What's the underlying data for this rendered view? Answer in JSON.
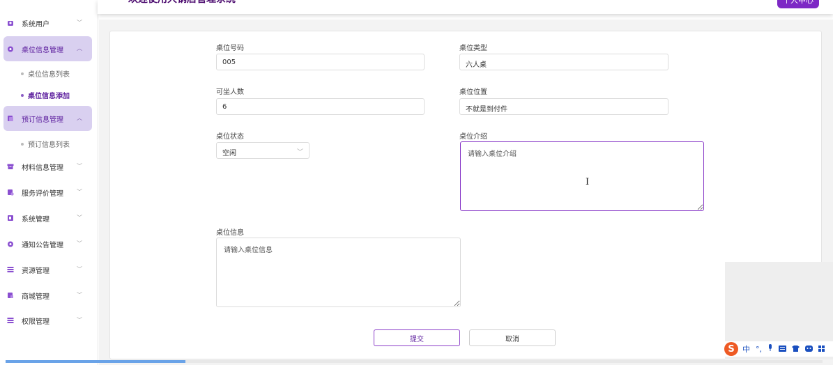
{
  "header": {
    "title": "欢迎使用大钢店管理系统",
    "user_button": "个人中心"
  },
  "sidebar": {
    "items": [
      {
        "label": "系统用户",
        "icon": "user-icon",
        "expanded": false
      },
      {
        "label": "桌位信息管理",
        "icon": "table-icon",
        "expanded": true,
        "children": [
          {
            "label": "桌位信息列表"
          },
          {
            "label": "桌位信息添加",
            "active": true
          }
        ]
      },
      {
        "label": "预订信息管理",
        "icon": "booking-icon",
        "expanded": true,
        "children": [
          {
            "label": "预订信息列表"
          }
        ]
      },
      {
        "label": "材料信息管理",
        "icon": "material-icon",
        "expanded": false
      },
      {
        "label": "服务评价管理",
        "icon": "review-icon",
        "expanded": false
      },
      {
        "label": "系统管理",
        "icon": "system-icon",
        "expanded": false
      },
      {
        "label": "通知公告管理",
        "icon": "notice-icon",
        "expanded": false
      },
      {
        "label": "资源管理",
        "icon": "resource-icon",
        "expanded": false
      },
      {
        "label": "商城管理",
        "icon": "shop-icon",
        "expanded": false
      },
      {
        "label": "权限管理",
        "icon": "permission-icon",
        "expanded": false
      }
    ]
  },
  "form": {
    "table_number": {
      "label": "桌位号码",
      "value": "005"
    },
    "table_type": {
      "label": "桌位类型",
      "value": "六人桌"
    },
    "seats": {
      "label": "可坐人数",
      "value": "6"
    },
    "location": {
      "label": "桌位位置",
      "value": "不就是到付件"
    },
    "status": {
      "label": "桌位状态",
      "value": "空闲"
    },
    "intro": {
      "label": "桌位介绍",
      "placeholder": "请输入桌位介绍"
    },
    "info": {
      "label": "桌位信息",
      "placeholder": "请输入桌位信息"
    },
    "submit_label": "提交",
    "cancel_label": "取消"
  },
  "ime": {
    "logo": "S",
    "mode": "中",
    "punct": "°,"
  },
  "page_progress": 0.22,
  "colors": {
    "accent": "#7d28c5",
    "active_menu_bg": "#d9d0f0",
    "active_text": "#5b1c9d"
  }
}
